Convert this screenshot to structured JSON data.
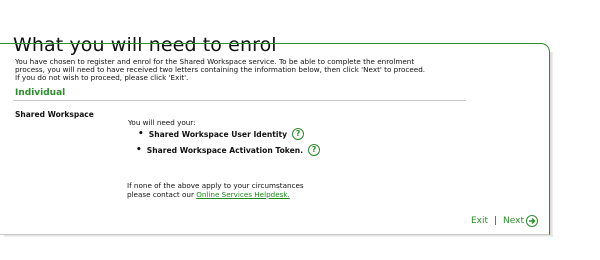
{
  "header": {
    "title": "What you will need to enrol"
  },
  "intro": {
    "line1": "You have chosen to register and enrol for the Shared Workspace service. To be able to complete the enrolment",
    "line2": "process, you will need to have received two letters containing the information below, then click 'Next' to proceed.",
    "line3": "If you do not wish to proceed, please click 'Exit'."
  },
  "section": {
    "heading": "Individual"
  },
  "item": {
    "label": "Shared Workspace",
    "needs_intro": "You will need your:",
    "requirements": [
      {
        "text": "Shared Workspace User Identity",
        "help": "?"
      },
      {
        "text": "Shared Workspace Activation Token.",
        "help": "?"
      }
    ]
  },
  "fallback": {
    "line1": "If none of the above apply to your circumstances",
    "line2_prefix": "please contact our ",
    "link": "Online Services Helpdesk."
  },
  "footer": {
    "exit": "Exit",
    "separator": "|",
    "next": "Next",
    "next_icon": "arrow-right-circle-icon"
  },
  "colors": {
    "accent": "#2e8b2e",
    "link": "#1f8a1f"
  }
}
